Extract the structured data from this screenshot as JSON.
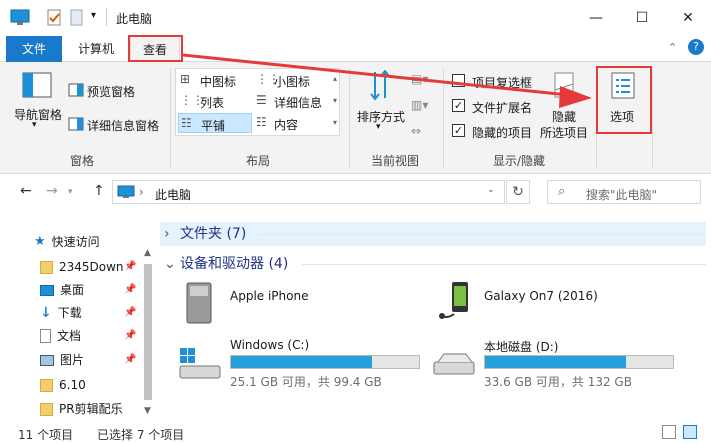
{
  "window": {
    "title": "此电脑",
    "controls": {
      "minimize": "—",
      "maximize": "☐",
      "close": "✕"
    }
  },
  "ribbon": {
    "tabs": {
      "file": "文件",
      "computer": "计算机",
      "view": "查看"
    },
    "panes": {
      "nav_pane": "导航窗格",
      "preview_pane": "预览窗格",
      "details_pane": "详细信息窗格",
      "group_label": "窗格"
    },
    "layout": {
      "medium_icons": "中图标",
      "small_icons": "小图标",
      "list": "列表",
      "details": "详细信息",
      "tiles": "平铺",
      "content": "内容",
      "group_label": "布局"
    },
    "current_view": {
      "sort_by": "排序方式",
      "group_label": "当前视图"
    },
    "show_hide": {
      "item_checkboxes": "项目复选框",
      "file_extensions": "文件扩展名",
      "hidden_items": "隐藏的项目",
      "hide_selected_1": "隐藏",
      "hide_selected_2": "所选项目",
      "group_label": "显示/隐藏",
      "item_checkboxes_checked": false,
      "file_extensions_checked": true,
      "hidden_items_checked": true
    },
    "options": "选项"
  },
  "address": {
    "path": "此电脑",
    "search_placeholder": "搜索\"此电脑\""
  },
  "nav": {
    "quick_access": "快速访问",
    "items": [
      {
        "label": "2345Down",
        "pinned": true
      },
      {
        "label": "桌面",
        "pinned": true
      },
      {
        "label": "下载",
        "pinned": true
      },
      {
        "label": "文档",
        "pinned": true
      },
      {
        "label": "图片",
        "pinned": true
      },
      {
        "label": "6.10",
        "pinned": false
      },
      {
        "label": "PR剪辑配乐",
        "pinned": false
      }
    ]
  },
  "content": {
    "folders_header": "文件夹 (7)",
    "devices_header": "设备和驱动器 (4)",
    "devices": [
      {
        "name": "Apple iPhone"
      },
      {
        "name": "Galaxy On7 (2016)"
      }
    ],
    "drives": [
      {
        "name": "Windows (C:)",
        "info": "25.1 GB 可用，共 99.4 GB",
        "used_fraction": 0.75
      },
      {
        "name": "本地磁盘 (D:)",
        "info": "33.6 GB 可用，共 132 GB",
        "used_fraction": 0.75
      }
    ]
  },
  "status": {
    "count": "11 个项目",
    "selected": "已选择 7 个项目"
  },
  "colors": {
    "accent": "#1979ca",
    "drive_fill": "#26a0da",
    "highlight": "#e53a3a",
    "section_header": "#1e3287"
  }
}
